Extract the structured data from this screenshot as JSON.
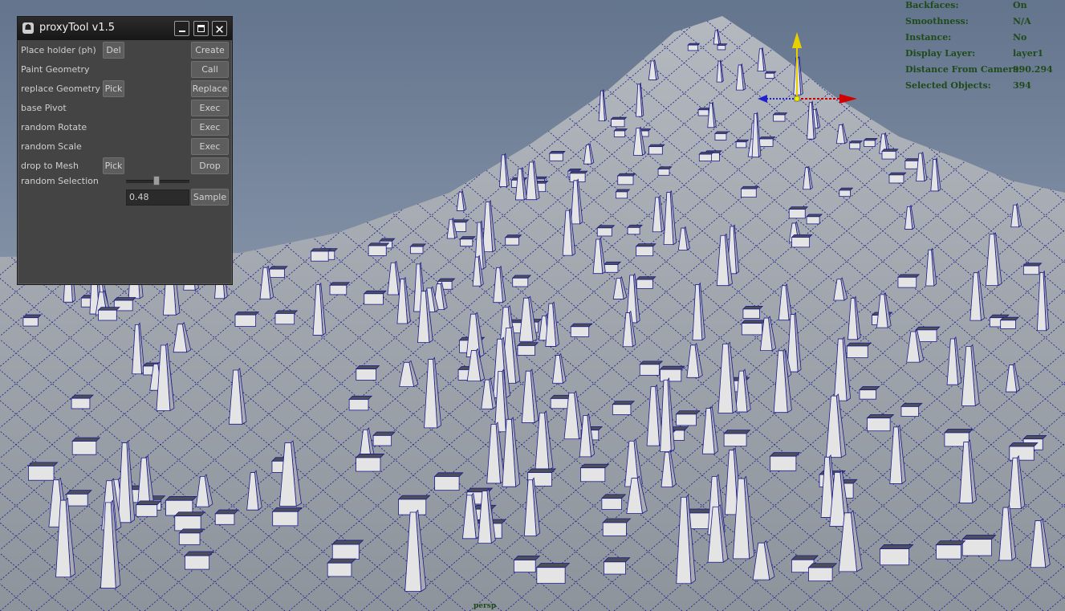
{
  "window": {
    "title": "proxyTool v1.5",
    "app_icon": "maya-logo-icon"
  },
  "rows": {
    "place_holder": {
      "label": "Place holder (ph)",
      "small_button": "Del",
      "action_button": "Create"
    },
    "paint_geometry": {
      "label": "Paint Geometry",
      "action_button": "Call"
    },
    "replace_geometry": {
      "label": "replace Geometry",
      "small_button": "Pick",
      "action_button": "Replace"
    },
    "base_pivot": {
      "label": "base Pivot",
      "action_button": "Exec"
    },
    "random_rotate": {
      "label": "random Rotate",
      "action_button": "Exec"
    },
    "random_scale": {
      "label": "random Scale",
      "action_button": "Exec"
    },
    "drop_to_mesh": {
      "label": "drop to Mesh",
      "small_button": "Pick",
      "action_button": "Drop"
    },
    "random_selection": {
      "label": "random Selection",
      "value": "0.48",
      "slider_fraction": 0.48,
      "action_button": "Sample"
    }
  },
  "hud": [
    {
      "label": "Backfaces:",
      "value": "On"
    },
    {
      "label": "Smoothness:",
      "value": "N/A"
    },
    {
      "label": "Instance:",
      "value": "No"
    },
    {
      "label": "Display Layer:",
      "value": "layer1"
    },
    {
      "label": "Distance From Camera:",
      "value": "990.294"
    },
    {
      "label": "Selected Objects:",
      "value": "394"
    }
  ],
  "viewport": {
    "camera": "persp",
    "colors": {
      "sky_top": "#63748d",
      "sky_bottom": "#aab5c4",
      "ground": "#9aa0a8",
      "wire": "#1a1a8a",
      "object_fill": "#e4e4e4",
      "gizmo_y": "#e8d000",
      "gizmo_x": "#d00000",
      "gizmo_z": "#2222cc"
    }
  }
}
